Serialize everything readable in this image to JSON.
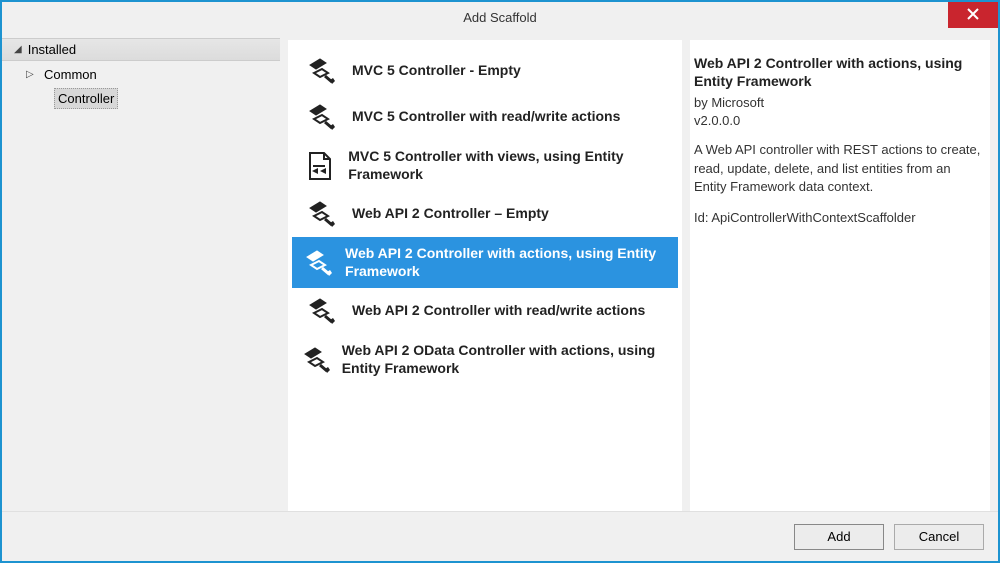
{
  "window": {
    "title": "Add Scaffold"
  },
  "sidebar": {
    "root": "Installed",
    "items": [
      {
        "label": "Common",
        "expanded": true,
        "selected": false
      },
      {
        "label": "Controller",
        "expanded": false,
        "selected": true
      }
    ]
  },
  "templates": [
    {
      "label": "MVC 5 Controller - Empty",
      "icon": "tool"
    },
    {
      "label": "MVC 5 Controller with read/write actions",
      "icon": "tool"
    },
    {
      "label": "MVC 5 Controller with views, using Entity Framework",
      "icon": "file"
    },
    {
      "label": "Web API 2 Controller – Empty",
      "icon": "tool"
    },
    {
      "label": "Web API 2 Controller with actions, using Entity Framework",
      "icon": "tool",
      "selected": true
    },
    {
      "label": "Web API 2 Controller with read/write actions",
      "icon": "tool"
    },
    {
      "label": "Web API 2 OData Controller with actions, using Entity Framework",
      "icon": "tool"
    }
  ],
  "detail": {
    "title": "Web API 2 Controller with actions, using Entity Framework",
    "by": "by Microsoft",
    "version": "v2.0.0.0",
    "description": "A Web API controller with REST actions to create, read, update, delete, and list entities from an Entity Framework data context.",
    "idline": "Id: ApiControllerWithContextScaffolder"
  },
  "buttons": {
    "add": "Add",
    "cancel": "Cancel"
  }
}
